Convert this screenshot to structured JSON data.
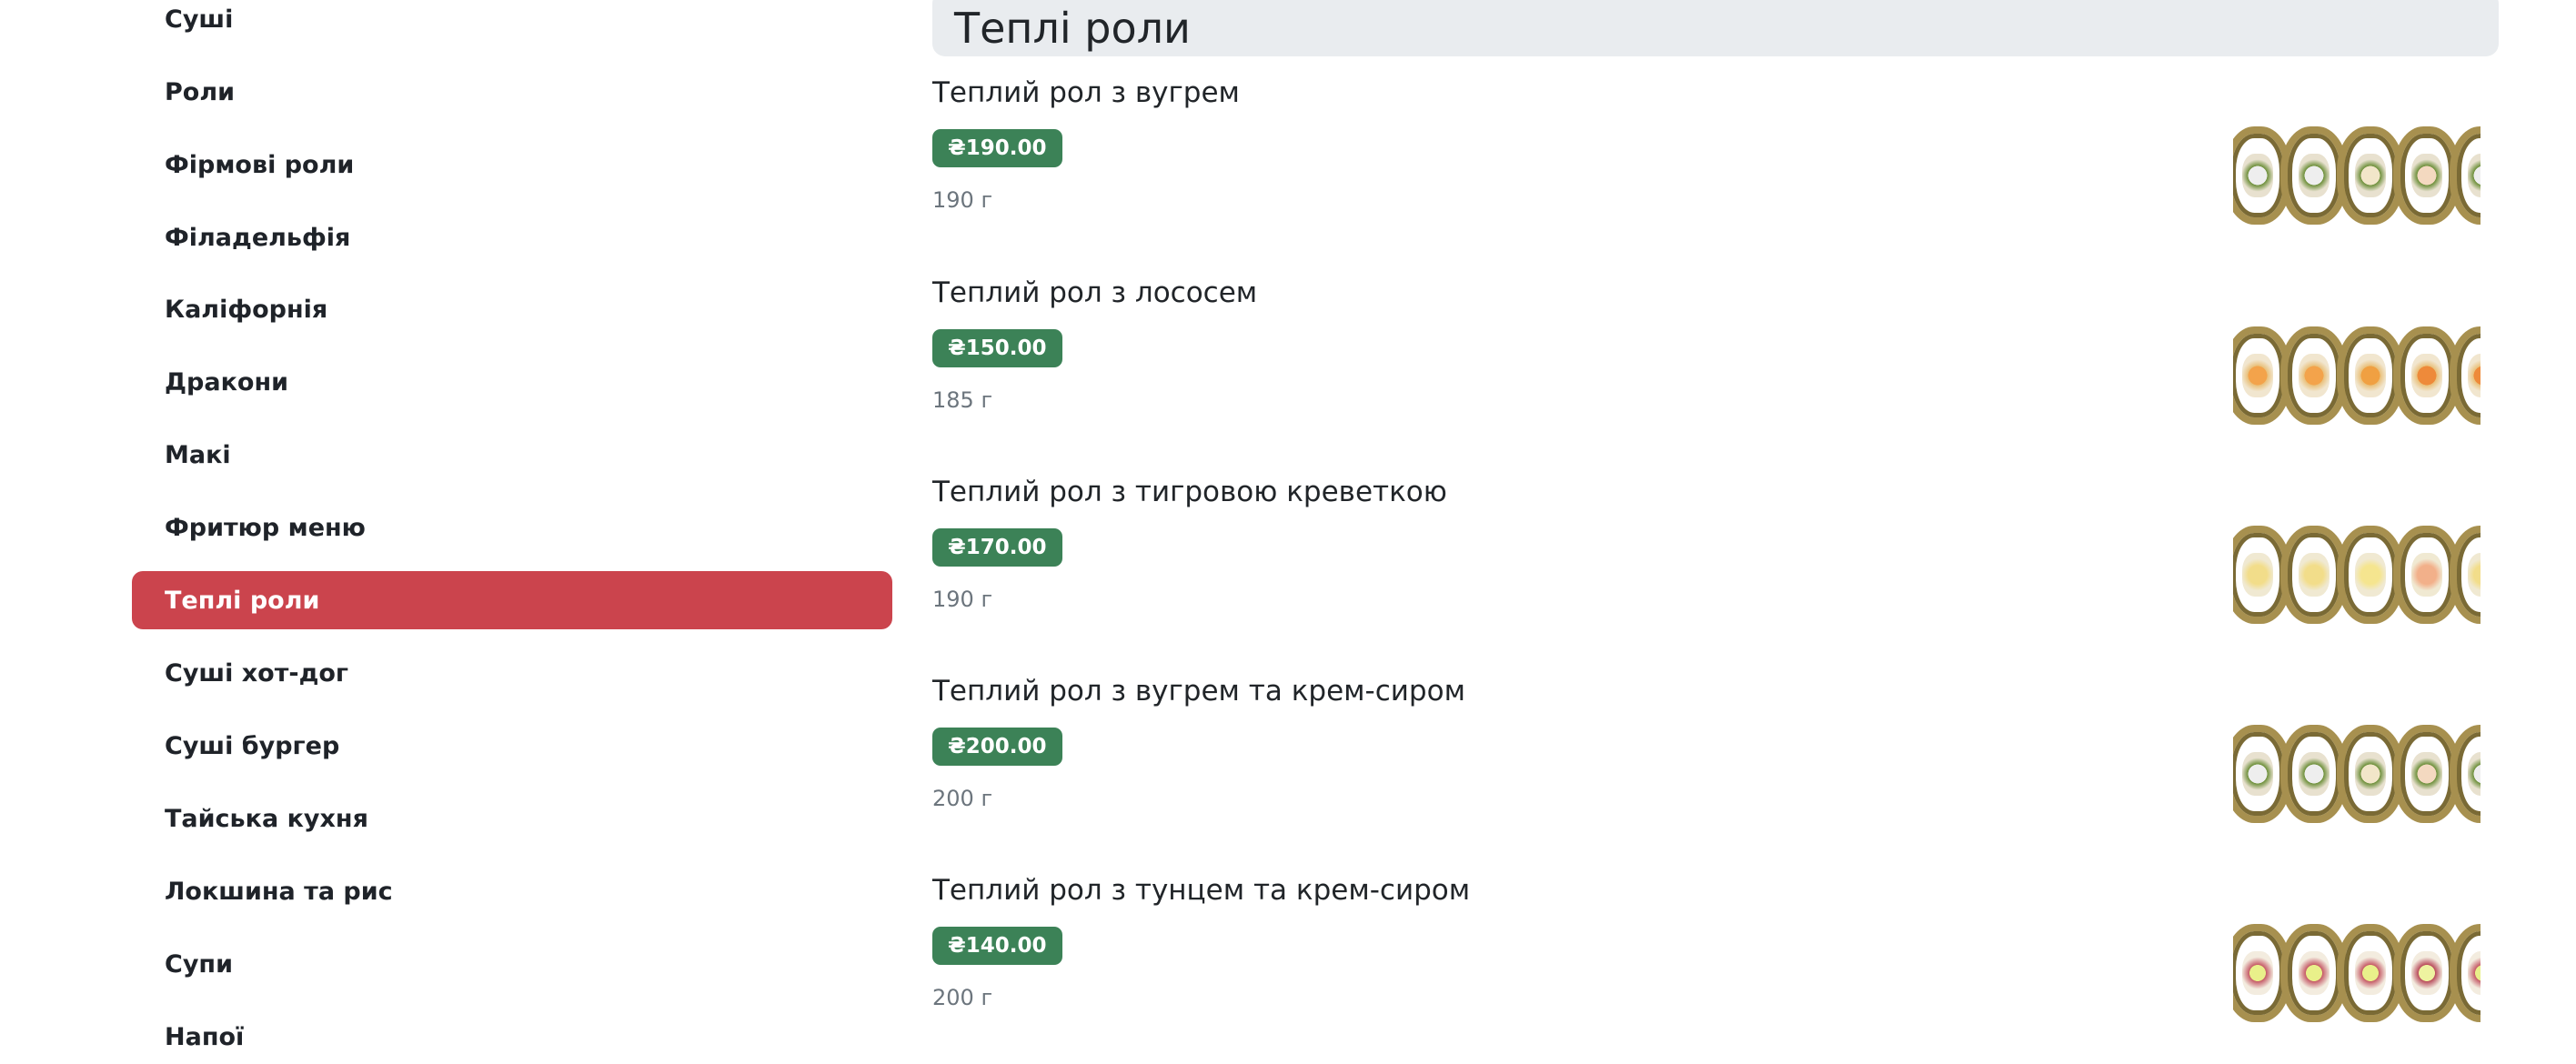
{
  "sidebar": {
    "items": [
      {
        "label": "Суші"
      },
      {
        "label": "Роли"
      },
      {
        "label": "Фірмові роли"
      },
      {
        "label": "Філадельфія"
      },
      {
        "label": "Каліфорнія"
      },
      {
        "label": "Дракони"
      },
      {
        "label": "Макі"
      },
      {
        "label": "Фритюр меню"
      },
      {
        "label": "Теплі роли",
        "active": true
      },
      {
        "label": "Суші хот-дог"
      },
      {
        "label": "Суші бургер"
      },
      {
        "label": "Тайська кухня"
      },
      {
        "label": "Локшина та рис"
      },
      {
        "label": "Супи"
      },
      {
        "label": "Напої"
      }
    ]
  },
  "section": {
    "title": "Теплі роли"
  },
  "products": [
    {
      "name": "Теплий рол з вугрем",
      "price": "₴190.00",
      "weight": "190 г",
      "image_icon": "warm-roll-eel-image"
    },
    {
      "name": "Теплий рол з лососем",
      "price": "₴150.00",
      "weight": "185 г",
      "image_icon": "warm-roll-salmon-image"
    },
    {
      "name": "Теплий рол з тигровою креветкою",
      "price": "₴170.00",
      "weight": "190 г",
      "image_icon": "warm-roll-shrimp-image"
    },
    {
      "name": "Теплий рол з вугрем та крем-сиром",
      "price": "₴200.00",
      "weight": "200 г",
      "image_icon": "warm-roll-eel-cheese-image"
    },
    {
      "name": "Теплий рол з тунцем та крем-сиром",
      "price": "₴140.00",
      "weight": "200 г",
      "image_icon": "warm-roll-tuna-cheese-image"
    }
  ],
  "colors": {
    "active_nav": "#cb444d",
    "price_badge": "#3c8257",
    "section_header_bg": "#e9ecef",
    "muted_text": "#6c757d"
  }
}
